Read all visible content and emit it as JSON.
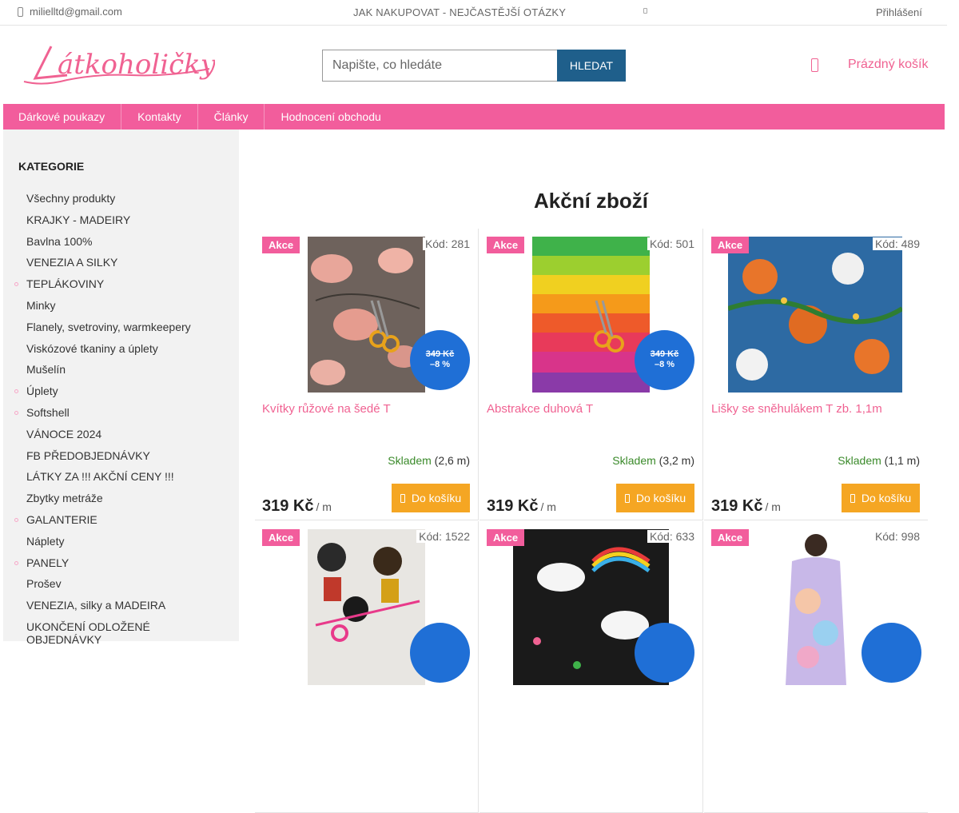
{
  "topbar": {
    "email": "milielltd@gmail.com",
    "help": "JAK NAKUPOVAT - NEJČASTĚJŠÍ OTÁZKY",
    "login": "Přihlášení"
  },
  "logo": {
    "text": "Látkoholičky"
  },
  "search": {
    "placeholder": "Napište, co hledáte",
    "button": "HLEDAT"
  },
  "cart": {
    "label": "Prázdný košík"
  },
  "nav": {
    "items": [
      "Dárkové poukazy",
      "Kontakty",
      "Články",
      "Hodnocení obchodu"
    ]
  },
  "sidebar": {
    "title": "KATEGORIE",
    "items": [
      "Všechny produkty",
      "KRAJKY - MADEIRY",
      "Bavlna 100%",
      "VENEZIA A SILKY",
      "TEPLÁKOVINY",
      "Minky",
      "Flanely, svetroviny, warmkeepery",
      "Viskózové tkaniny a úplety",
      "Mušelín",
      "Úplety",
      "Softshell",
      "VÁNOCE 2024",
      "FB PŘEDOBJEDNÁVKY",
      "LÁTKY ZA !!! AKČNÍ CENY !!!",
      "Zbytky metráže",
      "GALANTERIE",
      "Náplety",
      "PANELY",
      "Prošev",
      "VENEZIA, silky a MADEIRA",
      "UKONČENÍ ODLOŽENÉ OBJEDNÁVKY"
    ]
  },
  "main": {
    "title": "Akční zboží",
    "badge": "Akce",
    "code_prefix": "Kód:",
    "stock_label": "Skladem",
    "buy_label": "Do košíku",
    "unit": "/ m",
    "products": [
      {
        "code": "Kód: 281",
        "name": "Kvítky růžové na šedé T",
        "stock": "(2,6 m)",
        "price": "319 Kč",
        "old_price": "349 Kč",
        "discount": "–8 %"
      },
      {
        "code": "Kód: 501",
        "name": "Abstrakce duhová T",
        "stock": "(3,2 m)",
        "price": "319 Kč",
        "old_price": "349 Kč",
        "discount": "–8 %"
      },
      {
        "code": "Kód: 489",
        "name": "Lišky se sněhulákem T zb. 1,1m",
        "stock": "(1,1 m)",
        "price": "319 Kč"
      },
      {
        "code": "Kód: 1522"
      },
      {
        "code": "Kód: 633"
      },
      {
        "code": "Kód: 998"
      }
    ]
  }
}
